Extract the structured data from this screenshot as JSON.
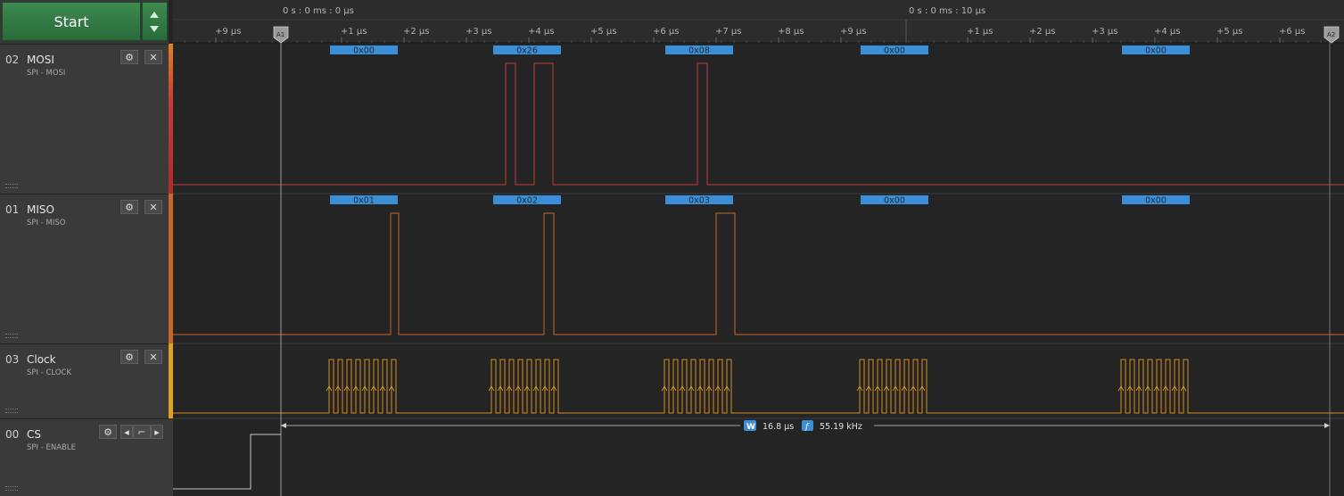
{
  "start_button": {
    "label": "Start"
  },
  "timeline": {
    "origin_label": "0 s : 0 ms : 0 μs",
    "origin2_label": "0 s : 0 ms : 10 μs",
    "ticks": [
      "+9 μs",
      "+1 μs",
      "+2 μs",
      "+3 μs",
      "+4 μs",
      "+5 μs",
      "+6 μs",
      "+7 μs",
      "+8 μs",
      "+9 μs",
      "+1 μs",
      "+2 μs",
      "+3 μs",
      "+4 μs",
      "+5 μs",
      "+6 μs"
    ],
    "marker_a1": "A1",
    "marker_a2": "A2"
  },
  "channels": [
    {
      "num": "02",
      "name": "MOSI",
      "analyzer": "SPI - MOSI",
      "color": "#c43a3a",
      "packets": [
        "0x00",
        "0x26",
        "0x08",
        "0x00",
        "0x00"
      ]
    },
    {
      "num": "01",
      "name": "MISO",
      "analyzer": "SPI - MISO",
      "color": "#c8672a",
      "packets": [
        "0x01",
        "0x02",
        "0x03",
        "0x00",
        "0x00"
      ]
    },
    {
      "num": "03",
      "name": "Clock",
      "analyzer": "SPI - CLOCK",
      "color": "#d98b1e"
    },
    {
      "num": "00",
      "name": "CS",
      "analyzer": "SPI - ENABLE",
      "color": "#c9c9c9"
    }
  ],
  "measurement": {
    "width_badge": "W",
    "width": "16.8 μs",
    "freq_badge": "f",
    "frequency": "55.19 kHz"
  },
  "icons": {
    "settings": "gear-icon",
    "close": "close-icon",
    "prev": "prev-edge-icon",
    "edge": "edge-icon",
    "next": "next-edge-icon"
  }
}
